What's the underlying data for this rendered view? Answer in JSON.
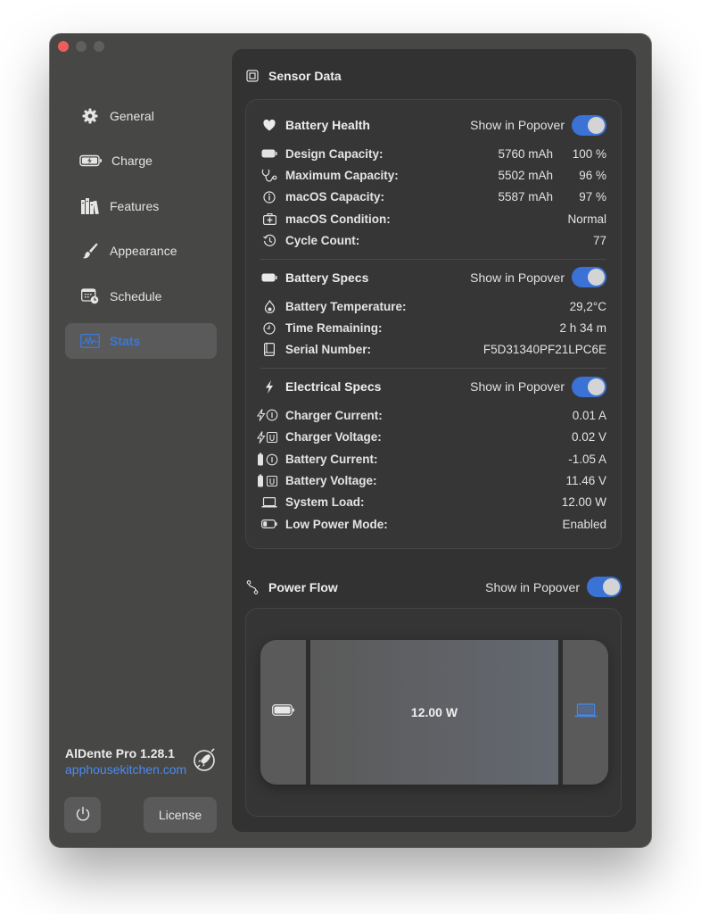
{
  "window": {
    "traffic_lights": [
      "close",
      "minimize",
      "zoom"
    ]
  },
  "sidebar": {
    "items": [
      {
        "label": "General",
        "icon": "gear-icon",
        "active": false
      },
      {
        "label": "Charge",
        "icon": "battery-charging-icon",
        "active": false
      },
      {
        "label": "Features",
        "icon": "books-icon",
        "active": false
      },
      {
        "label": "Appearance",
        "icon": "paintbrush-icon",
        "active": false
      },
      {
        "label": "Schedule",
        "icon": "calendar-clock-icon",
        "active": false
      },
      {
        "label": "Stats",
        "icon": "waveform-chart-icon",
        "active": true
      }
    ],
    "app_name": "AlDente Pro 1.28.1",
    "app_link": "apphousekitchen.com",
    "license_label": "License"
  },
  "colors": {
    "accent": "#3a72d6",
    "link": "#4b8af0",
    "close": "#ec5f59"
  },
  "main": {
    "sensor_title": "Sensor Data",
    "groups": [
      {
        "title": "Battery Health",
        "popover_label": "Show in Popover",
        "popover_on": true,
        "rows": [
          {
            "icon": "battery-full-icon",
            "label": "Design Capacity:",
            "value": "5760 mAh",
            "value2": "100 %"
          },
          {
            "icon": "stethoscope-icon",
            "label": "Maximum Capacity:",
            "value": "5502 mAh",
            "value2": "96 %"
          },
          {
            "icon": "info-circle-icon",
            "label": "macOS Capacity:",
            "value": "5587 mAh",
            "value2": "97 %"
          },
          {
            "icon": "medical-kit-icon",
            "label": "macOS Condition:",
            "value": "",
            "value2": "Normal"
          },
          {
            "icon": "history-icon",
            "label": "Cycle Count:",
            "value": "",
            "value2": "77"
          }
        ]
      },
      {
        "title": "Battery Specs",
        "popover_label": "Show in Popover",
        "popover_on": true,
        "rows": [
          {
            "icon": "thermometer-drop-icon",
            "label": "Battery Temperature:",
            "value": "29,2°C"
          },
          {
            "icon": "clock-icon",
            "label": "Time Remaining:",
            "value": "2 h 34 m"
          },
          {
            "icon": "book-icon",
            "label": "Serial Number:",
            "value": "F5D31340PF21LPC6E"
          }
        ]
      },
      {
        "title": "Electrical Specs",
        "popover_label": "Show in Popover",
        "popover_on": true,
        "rows": [
          {
            "icon": "charger-current-icon",
            "label": "Charger Current:",
            "value": "0.01 A"
          },
          {
            "icon": "charger-voltage-icon",
            "label": "Charger Voltage:",
            "value": "0.02 V"
          },
          {
            "icon": "battery-current-icon",
            "label": "Battery Current:",
            "value": "-1.05 A"
          },
          {
            "icon": "battery-voltage-icon",
            "label": "Battery Voltage:",
            "value": "11.46 V"
          },
          {
            "icon": "laptop-icon",
            "label": "System Load:",
            "value": "12.00 W"
          },
          {
            "icon": "battery-low-icon",
            "label": "Low Power Mode:",
            "value": "Enabled"
          }
        ]
      }
    ],
    "power_flow": {
      "title": "Power Flow",
      "popover_label": "Show in Popover",
      "popover_on": true,
      "flow_value": "12.00 W",
      "source_icon": "battery-icon",
      "sink_icon": "laptop-icon"
    }
  }
}
